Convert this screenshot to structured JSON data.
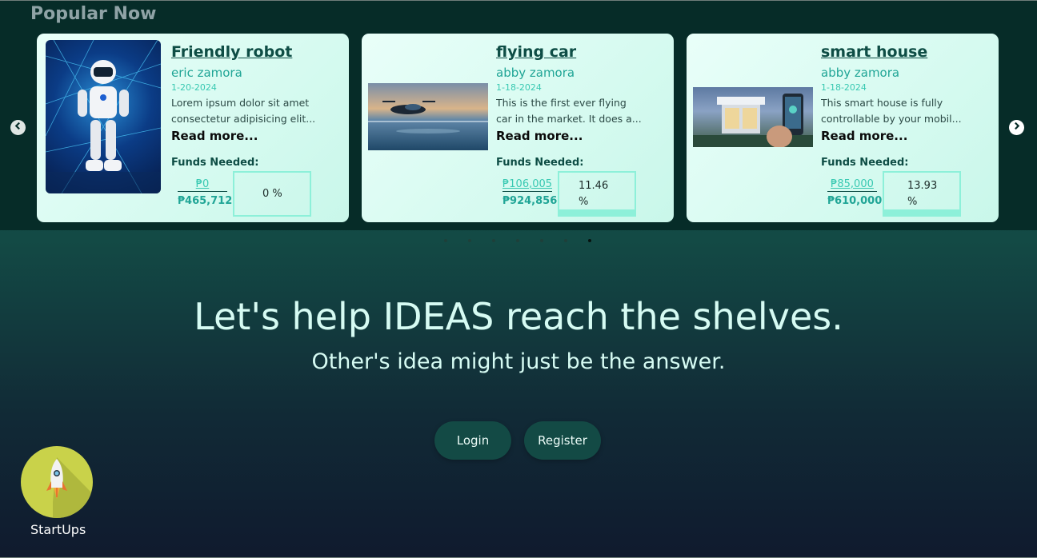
{
  "section": {
    "title": "Popular Now"
  },
  "nav": {
    "prev": "‹",
    "next": "›"
  },
  "cards": [
    {
      "title": "Friendly robot",
      "author": "eric zamora",
      "date": "1-20-2024",
      "desc_line1": "Lorem ipsum dolor sit amet",
      "desc_line2": "consectetur adipisicing elit...",
      "read_more": "Read more...",
      "funds_label": "Funds Needed:",
      "raised": "₱0",
      "goal": "₱465,712",
      "percent_text": "0 %",
      "percent": 0
    },
    {
      "title": "flying car",
      "author": "abby zamora",
      "date": "1-18-2024",
      "desc_line1": "This is the first ever flying",
      "desc_line2": "car in the market. It does a...",
      "read_more": "Read more...",
      "funds_label": "Funds Needed:",
      "raised": "₱106,005",
      "goal": "₱924,856",
      "percent_line1": "11.46",
      "percent_line2": "%",
      "percent": 11.46
    },
    {
      "title": "smart house",
      "author": "abby zamora",
      "date": "1-18-2024",
      "desc_line1": "This smart house is fully",
      "desc_line2": "controllable by your mobil...",
      "read_more": "Read more...",
      "funds_label": "Funds Needed:",
      "raised": "₱85,000",
      "goal": "₱610,000",
      "percent_line1": "13.93",
      "percent_line2": "%",
      "percent": 13.93
    }
  ],
  "carousel": {
    "dot_count": 7,
    "active_index": 6
  },
  "hero": {
    "headline": "Let's help IDEAS reach the shelves.",
    "subline": "Other's idea might just be the answer."
  },
  "buttons": {
    "login": "Login",
    "register": "Register"
  },
  "brand": {
    "name": "StartUps",
    "logo_icon": "rocket-icon"
  }
}
